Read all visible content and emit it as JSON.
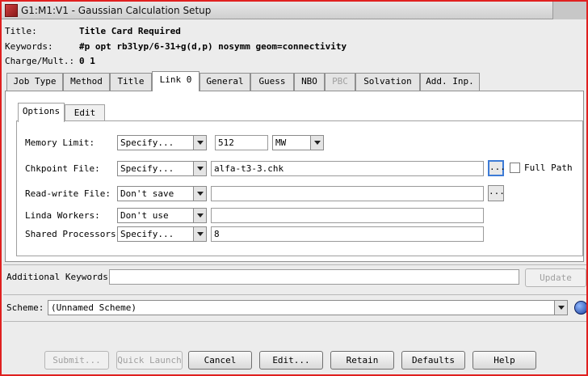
{
  "window": {
    "title": "G1:M1:V1 - Gaussian Calculation Setup"
  },
  "header": {
    "title_label": "Title:",
    "title_value": "Title Card Required",
    "keywords_label": "Keywords:",
    "keywords_value": "#p opt rb3lyp/6-31+g(d,p) nosymm geom=connectivity",
    "charge_label": "Charge/Mult.:",
    "charge_value": "0 1"
  },
  "tabs": [
    {
      "label": "Job Type"
    },
    {
      "label": "Method"
    },
    {
      "label": "Title"
    },
    {
      "label": "Link 0"
    },
    {
      "label": "General"
    },
    {
      "label": "Guess"
    },
    {
      "label": "NBO"
    },
    {
      "label": "PBC"
    },
    {
      "label": "Solvation"
    },
    {
      "label": "Add. Inp."
    }
  ],
  "subtabs": [
    {
      "label": "Options"
    },
    {
      "label": "Edit"
    }
  ],
  "form": {
    "memory": {
      "label": "Memory Limit:",
      "mode": "Specify...",
      "value": "512",
      "unit": "MW"
    },
    "chkpoint": {
      "label": "Chkpoint File:",
      "mode": "Specify...",
      "value": "alfa-t3-3.chk",
      "browse": "...",
      "fullpath_label": "Full Path"
    },
    "readwrite": {
      "label": "Read-write File:",
      "mode": "Don't save",
      "value": "",
      "browse": "..."
    },
    "linda": {
      "label": "Linda Workers:",
      "mode": "Don't use",
      "value": ""
    },
    "shared": {
      "label": "Shared Processors:",
      "mode": "Specify...",
      "value": "8"
    }
  },
  "additional": {
    "label": "Additional Keywords:",
    "value": "",
    "update_label": "Update"
  },
  "scheme": {
    "label": "Scheme:",
    "value": "(Unnamed Scheme)"
  },
  "buttons": {
    "submit": "Submit...",
    "quick_launch": "Quick Launch",
    "cancel": "Cancel",
    "edit": "Edit...",
    "retain": "Retain",
    "defaults": "Defaults",
    "help": "Help"
  },
  "icons": {
    "app": "gaussview-app-icon",
    "scheme_action": "globe-icon"
  }
}
